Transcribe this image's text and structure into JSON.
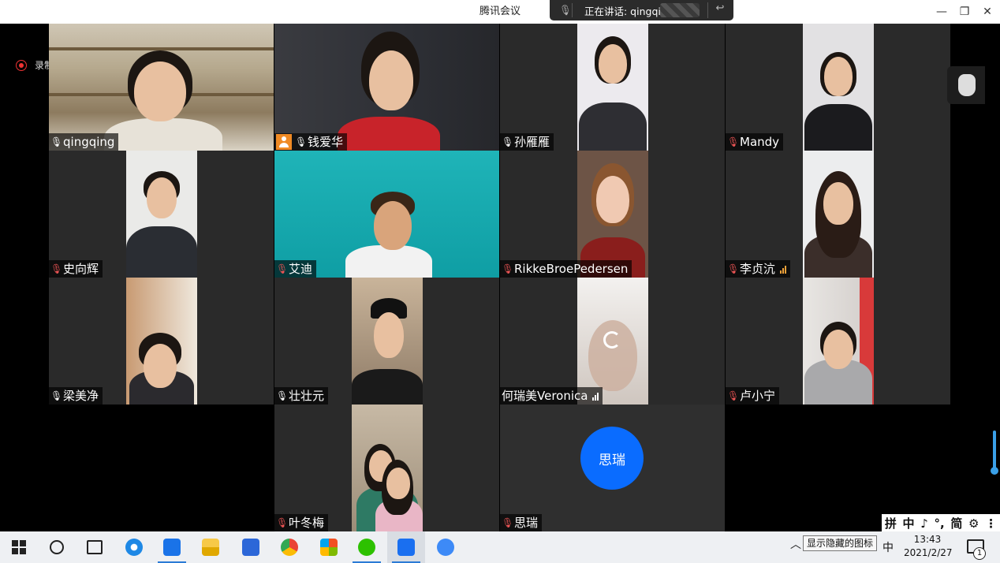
{
  "window": {
    "title": "腾讯会议",
    "speaking_label": "正在讲话: qingqing;",
    "minimize": "—",
    "maximize": "❐",
    "close": "✕"
  },
  "recording": {
    "label": "录制中"
  },
  "participants": [
    {
      "name": "qingqing",
      "mic": "on"
    },
    {
      "name": "钱爱华",
      "mic": "on"
    },
    {
      "name": "孙雁雁",
      "mic": "on"
    },
    {
      "name": "Mandy",
      "mic": "off"
    },
    {
      "name": "史向辉",
      "mic": "off"
    },
    {
      "name": "艾迪",
      "mic": "off"
    },
    {
      "name": "RikkeBroePedersen",
      "mic": "off"
    },
    {
      "name": "李贞沆",
      "mic": "off"
    },
    {
      "name": "梁美净",
      "mic": "on"
    },
    {
      "name": "壮壮元",
      "mic": "on"
    },
    {
      "name": "何瑞美Veronica",
      "mic": "none"
    },
    {
      "name": "卢小宁",
      "mic": "off"
    },
    {
      "name": "叶冬梅",
      "mic": "off"
    },
    {
      "name": "思瑞",
      "mic": "off",
      "avatar_text": "思瑞"
    }
  ],
  "ime_bar": {
    "items": [
      "拼",
      "中",
      "♪",
      "°,",
      "简",
      "⚙",
      "⋮"
    ]
  },
  "taskbar": {
    "apps": [
      "start",
      "search",
      "task-view",
      "ie",
      "app-blue",
      "file-explorer",
      "wps",
      "chrome",
      "windows-store",
      "wechat",
      "tencent-meeting",
      "feishu"
    ],
    "tooltip": "显示隐藏的图标",
    "ime_lang": "中",
    "time": "13:43",
    "date": "2021/2/27",
    "notification_count": "1"
  },
  "colors": {
    "accent_blue": "#0a6cff",
    "active_speaker": "#19c37d",
    "mic_muted": "#e55555"
  }
}
